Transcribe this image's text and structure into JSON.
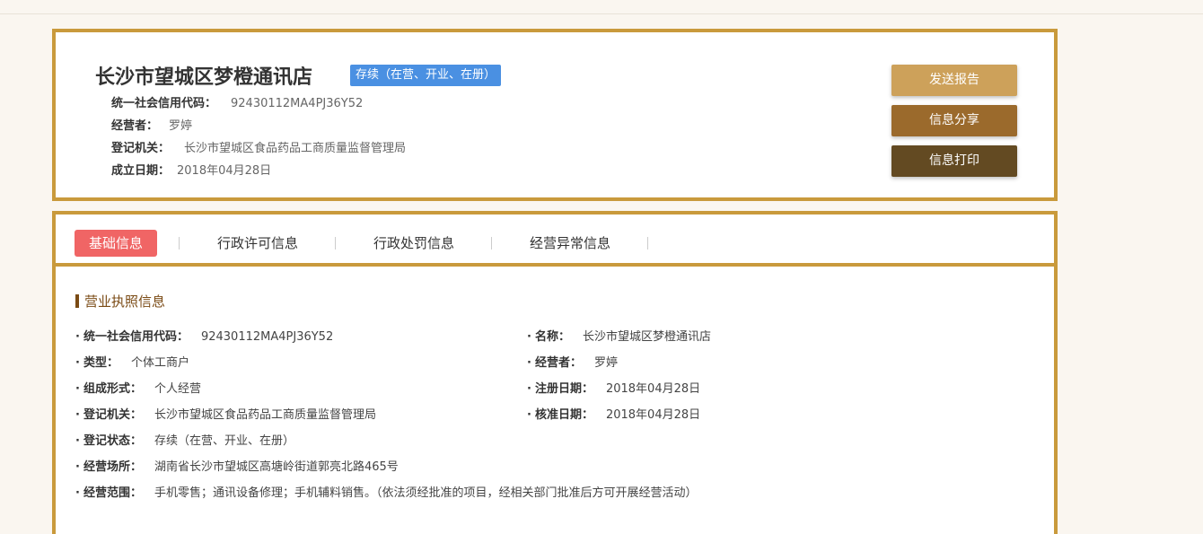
{
  "header": {
    "company_name": "长沙市望城区梦橙通讯店",
    "status": "存续（在营、开业、在册）",
    "credit_code_label": "统一社会信用代码：",
    "credit_code": "92430112MA4PJ36Y52",
    "operator_label": "经营者：",
    "operator": "罗婷",
    "authority_label": "登记机关：",
    "authority": "长沙市望城区食品药品工商质量监督管理局",
    "founded_label": "成立日期：",
    "founded": "2018年04月28日"
  },
  "actions": {
    "send_report": "发送报告",
    "share": "信息分享",
    "print": "信息打印"
  },
  "tabs": [
    "基础信息",
    "行政许可信息",
    "行政处罚信息",
    "经营异常信息"
  ],
  "section": {
    "title": "营业执照信息",
    "left_fields": [
      {
        "label": "统一社会信用代码：",
        "value": "92430112MA4PJ36Y52"
      },
      {
        "label": "类型：",
        "value": "个体工商户"
      },
      {
        "label": "组成形式：",
        "value": "个人经营"
      },
      {
        "label": "登记机关：",
        "value": "长沙市望城区食品药品工商质量监督管理局"
      },
      {
        "label": "登记状态：",
        "value": "存续（在营、开业、在册）"
      },
      {
        "label": "经营场所：",
        "value": "湖南省长沙市望城区高塘岭街道郭亮北路465号"
      },
      {
        "label": "经营范围：",
        "value": "手机零售；通讯设备修理；手机辅料销售。（依法须经批准的项目，经相关部门批准后方可开展经营活动）"
      }
    ],
    "right_fields": [
      {
        "label": "名称：",
        "value": "长沙市望城区梦橙通讯店"
      },
      {
        "label": "经营者：",
        "value": "罗婷"
      },
      {
        "label": "注册日期：",
        "value": "2018年04月28日"
      },
      {
        "label": "核准日期：",
        "value": "2018年04月28日"
      }
    ]
  },
  "colors": {
    "gold_border": "#c99a3c",
    "status_blue": "#4a90e2",
    "active_tab": "#f06565",
    "btn_send": "#cda15a",
    "btn_share": "#9b6a2c",
    "btn_print": "#634a22"
  }
}
